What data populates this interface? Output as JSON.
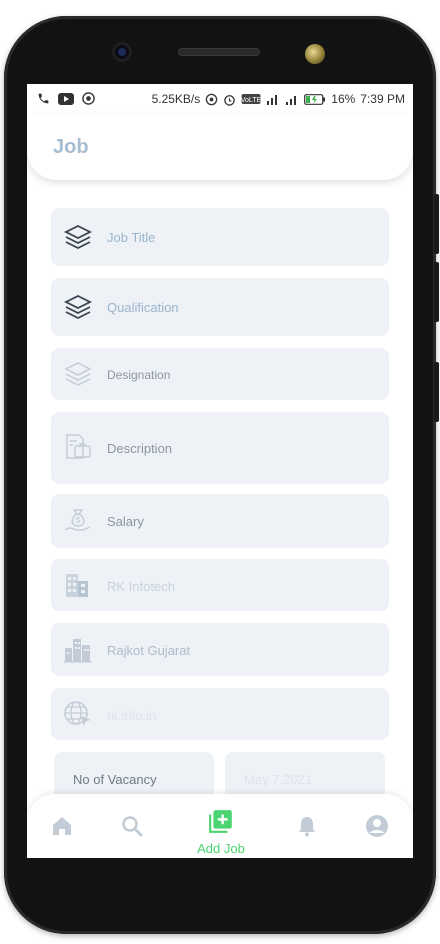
{
  "status": {
    "speed": "5.25KB/s",
    "battery": "16%",
    "time": "7:39 PM"
  },
  "header": {
    "title": "Job"
  },
  "form": {
    "job_title": "Job Title",
    "qualification": "Qualification",
    "designation": "Designation",
    "description": "Description",
    "salary": "Salary",
    "company": "RK Infotech",
    "location": "Rajkot Gujarat",
    "website": "rk.info.in",
    "vacancy": "No of Vacancy",
    "date": "May 7,2021"
  },
  "nav": {
    "add_job": "Add Job"
  },
  "colors": {
    "accent": "#4cd472",
    "muted": "#a7bccf",
    "field_bg": "#eef2f7"
  }
}
